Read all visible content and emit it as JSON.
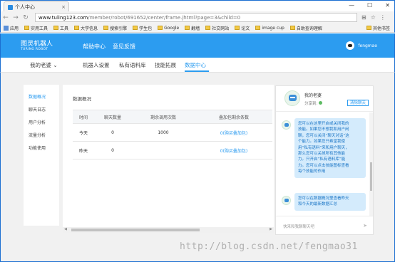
{
  "browser": {
    "tab_title": "个人中心",
    "tab_close": "×",
    "win_min": "—",
    "win_max": "☐",
    "win_close": "✕",
    "url_host": "www.tuling123.com",
    "url_path": "/member/robot/691652/center/frame.jhtml?page=3&child=0",
    "bookmarks": [
      "应用",
      "实用工具",
      "工具",
      "大学信息",
      "搜索引擎",
      "学生包",
      "Google",
      "翻墙",
      "社交网站",
      "论文",
      "image cup",
      "自助查询理解"
    ],
    "other_bookmarks": "其他书签"
  },
  "header": {
    "logo_line1": "图灵机器人",
    "logo_line2": "TURING ROBOT",
    "nav": [
      "帮助中心",
      "意见反馈"
    ],
    "username": "fengmao"
  },
  "subnav": {
    "robot": "我的老婆",
    "items": [
      "机器人设置",
      "私有语料库",
      "技能拓展",
      "数据中心"
    ],
    "active": "数据中心"
  },
  "sidebar": {
    "items": [
      "数据概况",
      "聊天日志",
      "用户分析",
      "流量分析",
      "功能使用"
    ],
    "active": "数据概况"
  },
  "main": {
    "title": "数据概况",
    "table": {
      "headers": [
        "时间",
        "聊天数量",
        "剩余调用次数",
        "叠加包剩余条数"
      ],
      "rows": [
        [
          "今天",
          "0",
          "1000",
          "0(购买叠加包)"
        ],
        [
          "昨天",
          "0",
          "",
          "0(购买叠加包)"
        ]
      ]
    }
  },
  "chat": {
    "name": "我的老婆",
    "share_label": "分享到:",
    "clear_btn": "清除聊天",
    "msg1": "您可以在这里开启或关闭我的\n技能。如果您不想我和用户闲\n聊，您可以关闭“聊天对话”这\n个能力。如果您只希望我使\n用“私有语料”来和用户聊天，\n那么您可以关掉所有其他能\n力。只开启“私有语料库”能\n力。您可以点击技能图标查看\n每个技能的作用",
    "msg2": "您可以在数据概况里查看昨天\n和今天的最新数据汇总",
    "input_placeholder": "快来和我聊聊天吧"
  },
  "watermark": "http://blog.csdn.net/fengmao31"
}
